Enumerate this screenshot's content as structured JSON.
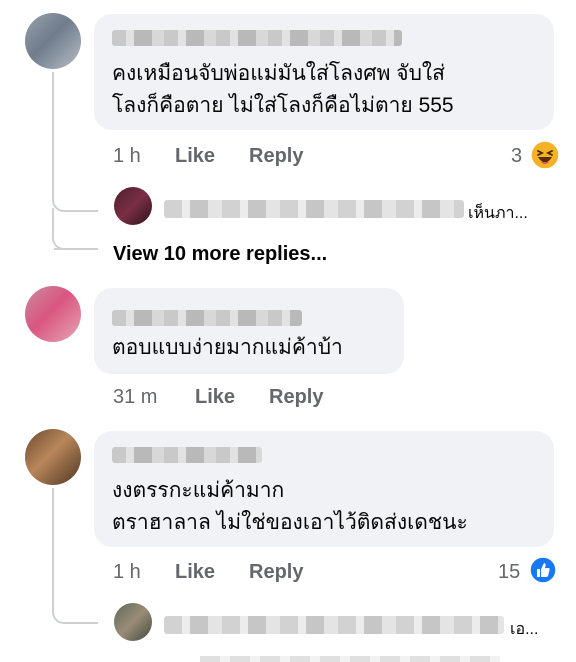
{
  "comments": [
    {
      "text_lines": [
        "คงเหมือนจับพ่อแม่มันใส่โลงศพ จับใส่",
        "โลงก็คือตาย ไม่ใส่โลงก็คือไม่ตาย 555"
      ],
      "time": "1 h",
      "like_label": "Like",
      "reply_label": "Reply",
      "reaction_count": "3",
      "reaction_icon": "haha-emoji-icon",
      "reaction_color": "#f7b125",
      "reply_preview_text": "เห็นภา..."
    },
    {
      "text_lines": [
        "ตอบแบบง่ายมากแม่ค้าบ้า"
      ],
      "time": "31 m",
      "like_label": "Like",
      "reply_label": "Reply"
    },
    {
      "text_lines": [
        "งงตรรกะแม่ค้ามาก",
        "ตราฮาลาล  ไม่ใช่ของเอาไว้ติดส่งเดชนะ"
      ],
      "time": "1 h",
      "like_label": "Like",
      "reply_label": "Reply",
      "reaction_count": "15",
      "reaction_icon": "like-thumb-icon",
      "reaction_color": "#1877f2",
      "reply_preview_text": "เอ..."
    }
  ],
  "view_more_replies": "View 10 more replies...",
  "colors": {
    "bubble": "#f0f2f5",
    "meta_text": "#65676b",
    "thread_line": "#ced0d4"
  }
}
